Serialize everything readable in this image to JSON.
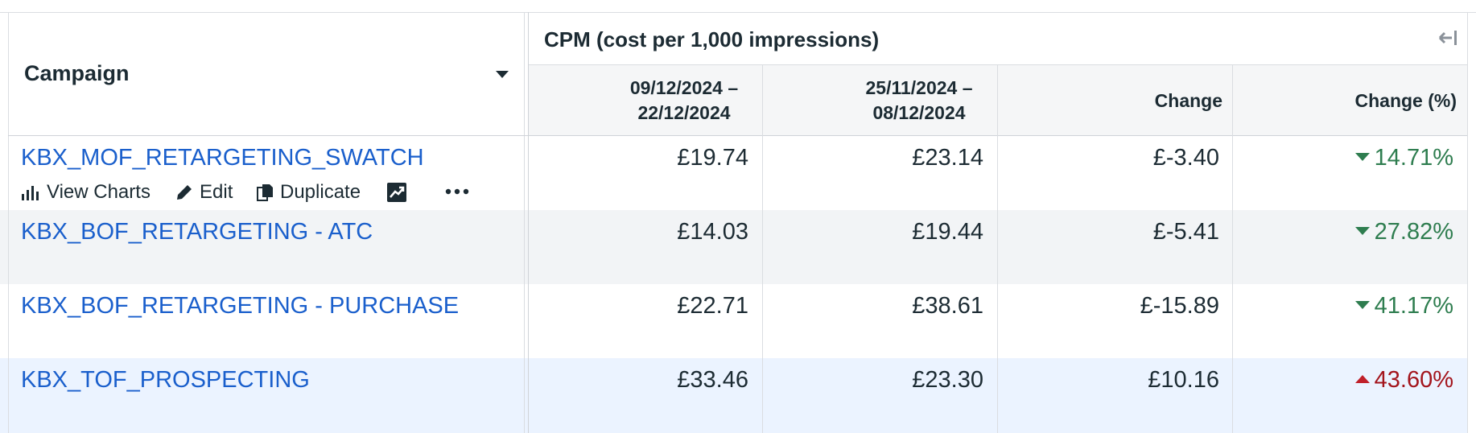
{
  "header": {
    "campaign_label": "Campaign",
    "metric_title": "CPM (cost per 1,000 impressions)",
    "col1_line1": "09/12/2024 –",
    "col1_line2": "22/12/2024",
    "col2_line1": "25/11/2024 –",
    "col2_line2": "08/12/2024",
    "change_label": "Change",
    "change_pct_label": "Change (%)"
  },
  "row_actions": {
    "view_charts": "View Charts",
    "edit": "Edit",
    "duplicate": "Duplicate"
  },
  "rows": [
    {
      "campaign": "KBX_MOF_RETARGETING_SWATCH",
      "current": "£19.74",
      "previous": "£23.14",
      "change": "£-3.40",
      "change_pct": "14.71%",
      "direction": "down"
    },
    {
      "campaign": "KBX_BOF_RETARGETING - ATC",
      "current": "£14.03",
      "previous": "£19.44",
      "change": "£-5.41",
      "change_pct": "27.82%",
      "direction": "down"
    },
    {
      "campaign": "KBX_BOF_RETARGETING - PURCHASE",
      "current": "£22.71",
      "previous": "£38.61",
      "change": "£-15.89",
      "change_pct": "41.17%",
      "direction": "down"
    },
    {
      "campaign": "KBX_TOF_PROSPECTING",
      "current": "£33.46",
      "previous": "£23.30",
      "change": "£10.16",
      "change_pct": "43.60%",
      "direction": "up"
    }
  ],
  "colors": {
    "link": "#1a5fcc",
    "decrease_good": "#2e7d4f",
    "increase_bad": "#a3141c",
    "row_alt": "#f2f4f6",
    "row_highlight": "#ebf3ff"
  }
}
